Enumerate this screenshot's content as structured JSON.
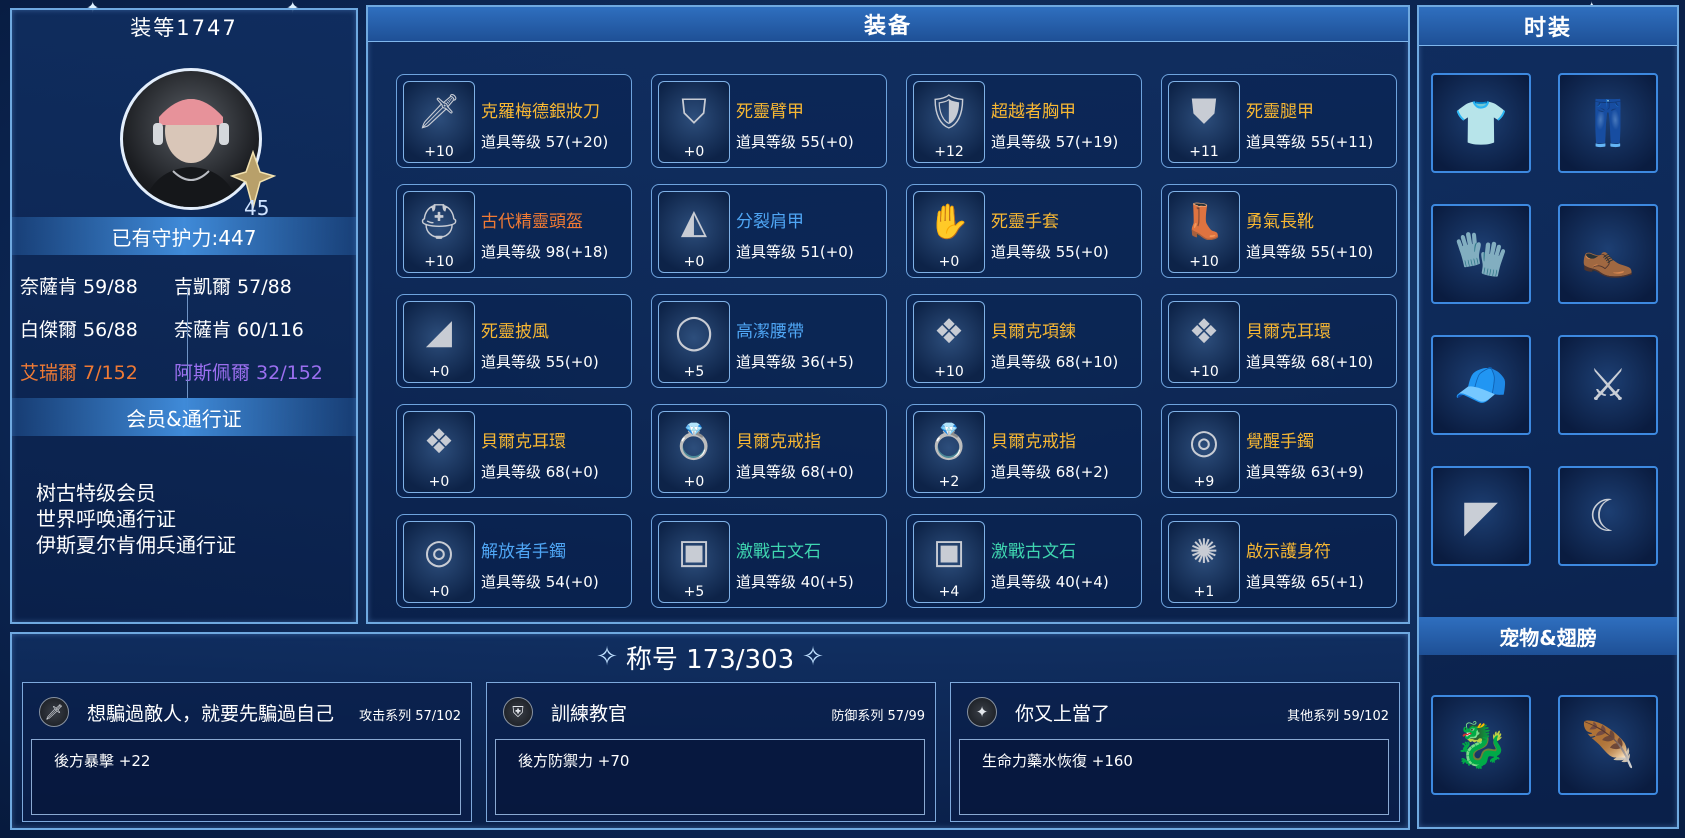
{
  "left_panel": {
    "item_level": "装等1747",
    "character_level": "45",
    "defense_label": "已有守护力:447",
    "stats": [
      {
        "text": "奈薩肯 59/88",
        "color": "#ffffff"
      },
      {
        "text": "吉凱爾 57/88",
        "color": "#ffffff"
      },
      {
        "text": "白傑爾 56/88",
        "color": "#ffffff"
      },
      {
        "text": "奈薩肯 60/116",
        "color": "#ffffff"
      },
      {
        "text": "艾瑞爾 7/152",
        "color": "#f07a34"
      },
      {
        "text": "阿斯佩爾 32/152",
        "color": "#9b6ff0"
      }
    ],
    "membership_title": "会员&通行证",
    "memberships": [
      "树古特级会员",
      "世界呼唤通行证",
      "伊斯夏尔肯佣兵通行证"
    ]
  },
  "equipment": {
    "title": "装备",
    "items": [
      {
        "name": "克羅梅德銀妝刀",
        "level": "道具等级 57(+20)",
        "plus": "+10",
        "color": "#f7b733",
        "icon": "dagger-icon"
      },
      {
        "name": "死靈臂甲",
        "level": "道具等级 55(+0)",
        "plus": "+0",
        "color": "#f7b733",
        "icon": "arm-guard-icon"
      },
      {
        "name": "超越者胸甲",
        "level": "道具等级 57(+19)",
        "plus": "+12",
        "color": "#f7b733",
        "icon": "chest-armor-icon"
      },
      {
        "name": "死靈腿甲",
        "level": "道具等级 55(+11)",
        "plus": "+11",
        "color": "#f7b733",
        "icon": "leg-armor-icon"
      },
      {
        "name": "古代精靈頭盔",
        "level": "道具等级 98(+18)",
        "plus": "+10",
        "color": "#f07a34",
        "icon": "helmet-icon"
      },
      {
        "name": "分裂肩甲",
        "level": "道具等级 51(+0)",
        "plus": "+0",
        "color": "#4fa6f5",
        "icon": "shoulder-armor-icon"
      },
      {
        "name": "死靈手套",
        "level": "道具等级 55(+0)",
        "plus": "+0",
        "color": "#f7b733",
        "icon": "glove-icon"
      },
      {
        "name": "勇氣長靴",
        "level": "道具等级 55(+10)",
        "plus": "+10",
        "color": "#f7b733",
        "icon": "boots-icon"
      },
      {
        "name": "死靈披風",
        "level": "道具等级 55(+0)",
        "plus": "+0",
        "color": "#f7b733",
        "icon": "cape-icon"
      },
      {
        "name": "高潔腰帶",
        "level": "道具等级 36(+5)",
        "plus": "+5",
        "color": "#4fa6f5",
        "icon": "belt-icon"
      },
      {
        "name": "貝爾克項鍊",
        "level": "道具等级 68(+10)",
        "plus": "+10",
        "color": "#f7b733",
        "icon": "necklace-icon"
      },
      {
        "name": "貝爾克耳環",
        "level": "道具等级 68(+10)",
        "plus": "+10",
        "color": "#f7b733",
        "icon": "earring-icon"
      },
      {
        "name": "貝爾克耳環",
        "level": "道具等级 68(+0)",
        "plus": "+0",
        "color": "#f7b733",
        "icon": "earring-icon"
      },
      {
        "name": "貝爾克戒指",
        "level": "道具等级 68(+0)",
        "plus": "+0",
        "color": "#f7b733",
        "icon": "ring-icon"
      },
      {
        "name": "貝爾克戒指",
        "level": "道具等级 68(+2)",
        "plus": "+2",
        "color": "#f7b733",
        "icon": "ring-icon"
      },
      {
        "name": "覺醒手鐲",
        "level": "道具等级 63(+9)",
        "plus": "+9",
        "color": "#f7b733",
        "icon": "bracelet-icon"
      },
      {
        "name": "解放者手鐲",
        "level": "道具等级 54(+0)",
        "plus": "+0",
        "color": "#4fa6f5",
        "icon": "bracelet-icon"
      },
      {
        "name": "激戰古文石",
        "level": "道具等级 40(+5)",
        "plus": "+5",
        "color": "#3fd6b0",
        "icon": "rune-stone-icon"
      },
      {
        "name": "激戰古文石",
        "level": "道具等级 40(+4)",
        "plus": "+4",
        "color": "#3fd6b0",
        "icon": "rune-stone-icon"
      },
      {
        "name": "啟示護身符",
        "level": "道具等级 65(+1)",
        "plus": "+1",
        "color": "#f7b733",
        "icon": "amulet-icon"
      }
    ]
  },
  "fashion": {
    "title": "时装",
    "slots": [
      {
        "icon": "costume-top-icon",
        "glyph": "👕"
      },
      {
        "icon": "costume-pants-icon",
        "glyph": "👖"
      },
      {
        "icon": "costume-gloves-icon",
        "glyph": "🧤"
      },
      {
        "icon": "costume-shoes-icon",
        "glyph": "👞"
      },
      {
        "icon": "costume-hat-icon",
        "glyph": "🧢"
      },
      {
        "icon": "costume-weapon-icon",
        "glyph": "⚔"
      },
      {
        "icon": "costume-cape-icon",
        "glyph": "◤"
      },
      {
        "icon": "costume-earring-icon",
        "glyph": "☾"
      }
    ],
    "pet_title": "宠物&翅膀",
    "pets": [
      {
        "icon": "pet-dragon-icon",
        "glyph": "🐉"
      },
      {
        "icon": "wings-icon",
        "glyph": "🪶"
      }
    ]
  },
  "titles": {
    "header": "称号 173/303",
    "cards": [
      {
        "name": "想騙過敵人，就要先騙過自己",
        "series": "攻击系列 57/102",
        "effect": "後方暴擊 +22",
        "icon": "sword-icon",
        "glyph": "🗡"
      },
      {
        "name": "訓練教官",
        "series": "防御系列 57/99",
        "effect": "後方防禦力 +70",
        "icon": "shield-icon",
        "glyph": "⛨"
      },
      {
        "name": "你又上當了",
        "series": "其他系列 59/102",
        "effect": "生命力藥水恢復 +160",
        "icon": "sparkle-icon",
        "glyph": "✦"
      }
    ]
  }
}
